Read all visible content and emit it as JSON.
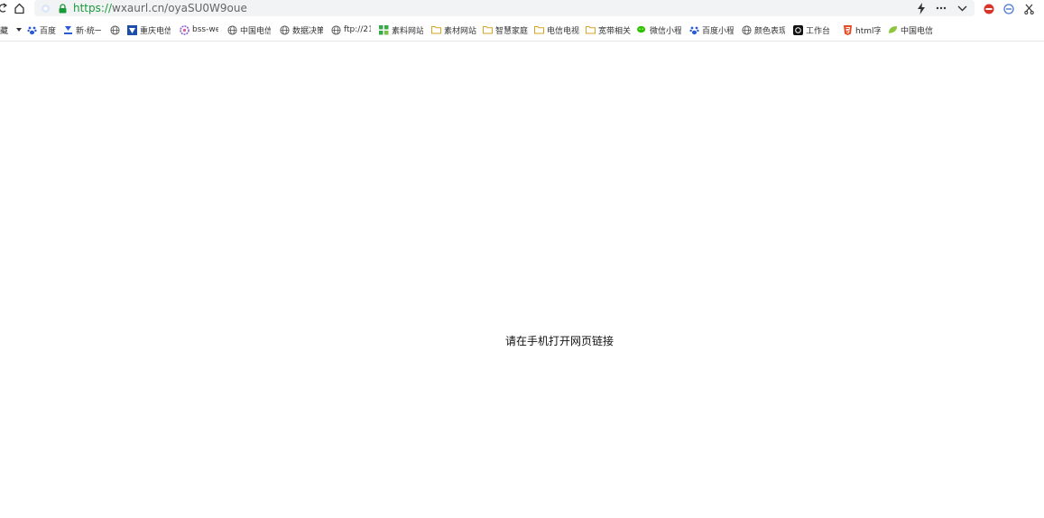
{
  "address_bar": {
    "url_scheme": "https://",
    "url_rest": "wxaurl.cn/oyaSU0W9oue"
  },
  "bookmarks": {
    "partial_first": "藏",
    "items": [
      {
        "label": "百度",
        "icon": "baidu-paw-icon"
      },
      {
        "label": "新·统一",
        "icon": "site-logo-icon"
      },
      {
        "label": "",
        "icon": "globe-icon"
      },
      {
        "label": "重庆电信",
        "icon": "telecom-logo-icon"
      },
      {
        "label": "bss-we",
        "icon": "flower-icon"
      },
      {
        "label": "中国电信",
        "icon": "globe-icon"
      },
      {
        "label": "数据决策",
        "icon": "globe-icon"
      },
      {
        "label": "ftp://21",
        "icon": "globe-icon"
      },
      {
        "label": "素料网站",
        "icon": "grid-icon"
      },
      {
        "label": "素材网站",
        "icon": "folder-icon"
      },
      {
        "label": "智慧家庭",
        "icon": "folder-icon"
      },
      {
        "label": "电信电视",
        "icon": "folder-icon"
      },
      {
        "label": "宽带相关",
        "icon": "folder-icon"
      },
      {
        "label": "微信小程",
        "icon": "wechat-icon"
      },
      {
        "label": "百度小程",
        "icon": "baidu-paw-icon"
      },
      {
        "label": "颜色表现",
        "icon": "globe-icon"
      },
      {
        "label": "工作台",
        "icon": "workbench-icon"
      },
      {
        "label": "html字",
        "icon": "html5-icon"
      },
      {
        "label": "中国电信",
        "icon": "leaf-icon"
      }
    ]
  },
  "page": {
    "message": "请在手机打开网页链接"
  },
  "colors": {
    "url_green": "#1a9a3a",
    "folder_yellow": "#f2c14e",
    "wechat_green": "#2dc100",
    "html5_red": "#e34c26"
  }
}
